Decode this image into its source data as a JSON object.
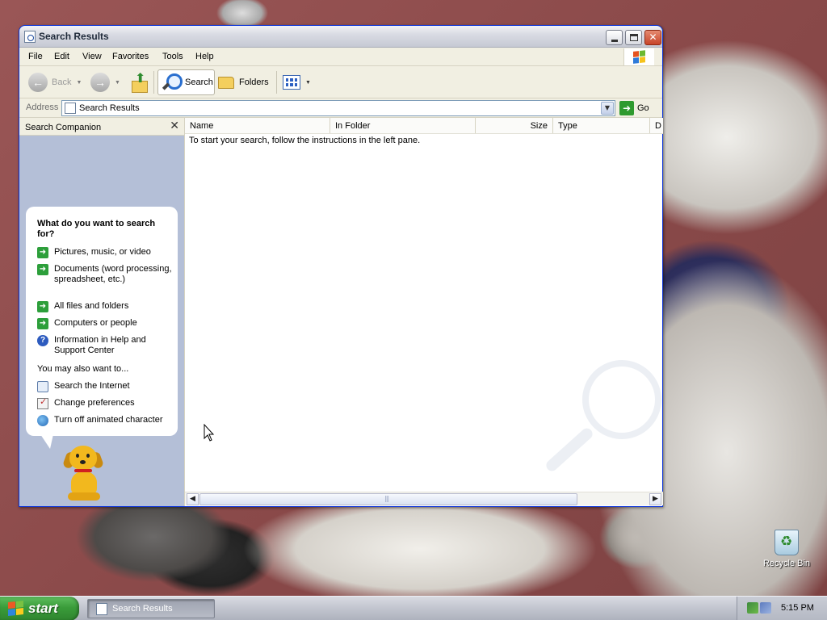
{
  "window": {
    "title": "Search Results",
    "menu": [
      "File",
      "Edit",
      "View",
      "Favorites",
      "Tools",
      "Help"
    ]
  },
  "toolbar": {
    "back_label": "Back",
    "search_label": "Search",
    "folders_label": "Folders"
  },
  "address": {
    "label": "Address",
    "value": "Search Results",
    "go_label": "Go"
  },
  "companion": {
    "title": "Search Companion",
    "question": "What do you want to search for?",
    "options": [
      "Pictures, music, or video",
      "Documents (word processing, spreadsheet, etc.)",
      "All files and folders",
      "Computers or people",
      "Information in Help and Support Center"
    ],
    "also_label": "You may also want to...",
    "also_options": [
      "Search the Internet",
      "Change preferences",
      "Turn off animated character"
    ]
  },
  "results": {
    "columns": [
      "Name",
      "In Folder",
      "Size",
      "Type",
      "D"
    ],
    "hint": "To start your search, follow the instructions in the left pane."
  },
  "desktop": {
    "recycle_bin_label": "Recycle Bin"
  },
  "taskbar": {
    "start_label": "start",
    "task_label": "Search Results",
    "clock": "5:15 PM"
  }
}
